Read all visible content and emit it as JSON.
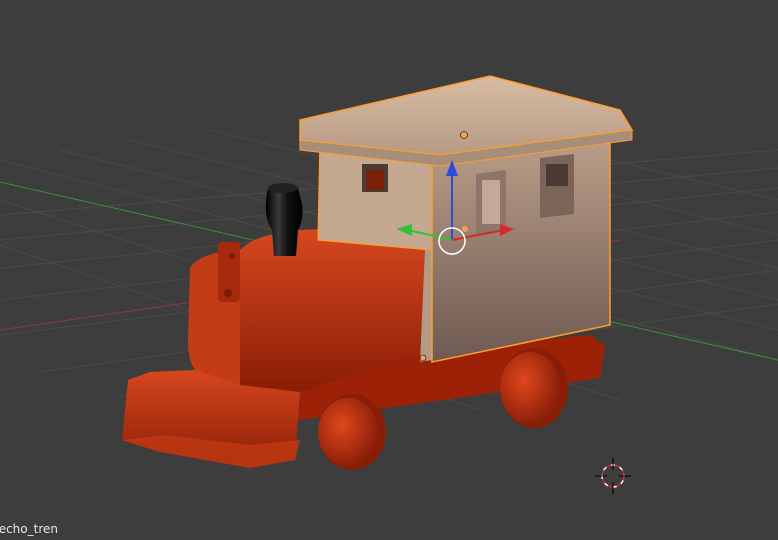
{
  "viewport": {
    "mode": "3D Viewport",
    "background_color": "#3d3d3d",
    "grid_color": "#4a4a4a",
    "x_axis_color": "#8c3a3a",
    "y_axis_color": "#3f8c3f",
    "selection_outline_color": "#ff9d2c",
    "object_name": "techo_tren"
  },
  "model": {
    "body_color": "#b82d10",
    "roof_color": "#c9a88c",
    "chimney_color": "#111111"
  },
  "gizmo": {
    "x_arrow_color": "#d42a2a",
    "y_arrow_color": "#35c035",
    "z_arrow_color": "#2b4bd8"
  }
}
